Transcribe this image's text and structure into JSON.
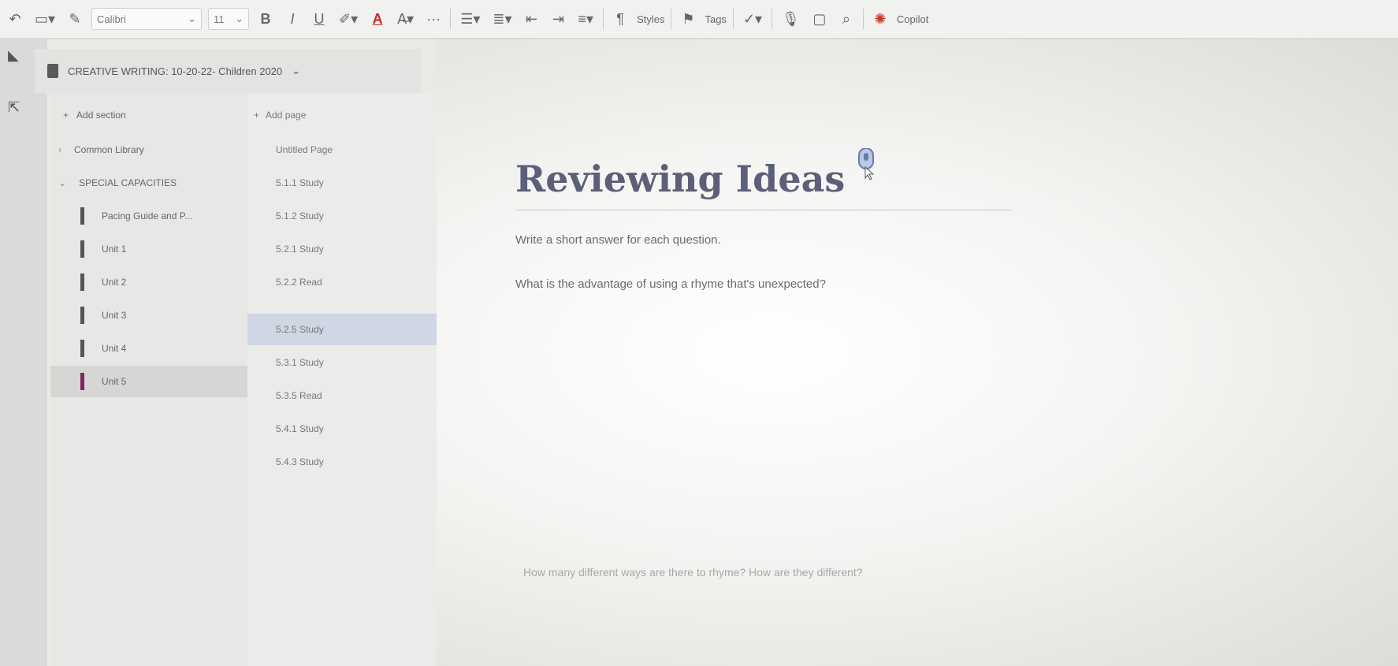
{
  "toolbar": {
    "font_name": "Calibri",
    "font_size": "11",
    "styles_label": "Styles",
    "tags_label": "Tags",
    "copilot_label": "Copilot",
    "accent_color": "#c42a2a"
  },
  "notebook": {
    "title": "CREATIVE WRITING: 10-20-22- Children 2020"
  },
  "actions": {
    "add_section": "Add section",
    "add_page": "Add page"
  },
  "sections": [
    {
      "label": "Common Library"
    },
    {
      "label": "SPECIAL CAPACITIES"
    },
    {
      "label": "Pacing Guide and P..."
    },
    {
      "label": "Unit 1"
    },
    {
      "label": "Unit 2"
    },
    {
      "label": "Unit 3"
    },
    {
      "label": "Unit 4"
    },
    {
      "label": "Unit 5"
    }
  ],
  "pages": [
    {
      "label": "Untitled Page"
    },
    {
      "label": "5.1.1 Study"
    },
    {
      "label": "5.1.2 Study"
    },
    {
      "label": "5.2.1 Study"
    },
    {
      "label": "5.2.2 Read"
    },
    {
      "label": "5.2.5 Study"
    },
    {
      "label": "5.3.1 Study"
    },
    {
      "label": "5.3.5 Read"
    },
    {
      "label": "5.4.1 Study"
    },
    {
      "label": "5.4.3 Study"
    }
  ],
  "page": {
    "title": "Reviewing Ideas",
    "prompt": "Write a short answer for each question.",
    "question_1": "What is the advantage of using a rhyme that's unexpected?",
    "question_2": "How many different ways are there to rhyme? How are they different?"
  }
}
